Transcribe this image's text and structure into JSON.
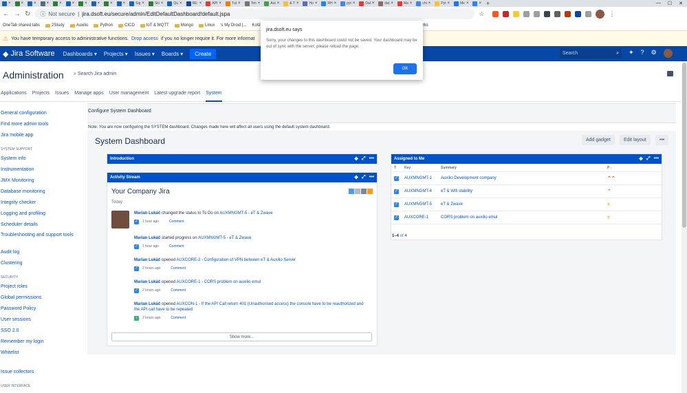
{
  "browser": {
    "tabs": [
      {
        "label": "",
        "color": "#1565c0"
      },
      {
        "label": "",
        "color": "#2e7d32"
      },
      {
        "label": "",
        "color": "#1565c0"
      },
      {
        "label": "",
        "color": "#546e7a"
      },
      {
        "label": "",
        "color": "#2e7d32"
      },
      {
        "label": "",
        "color": "#1565c0"
      },
      {
        "label": "",
        "color": "#2e7d32"
      },
      {
        "label": "",
        "color": "#1565c0"
      },
      {
        "label": "",
        "color": "#2e7d32"
      },
      {
        "label": "",
        "color": "#1565c0"
      },
      {
        "label": "Sig",
        "color": "#1565c0"
      },
      {
        "label": "Ski",
        "color": "#2e7d32"
      },
      {
        "label": "Qu",
        "color": "#1565c0"
      },
      {
        "label": "RE:",
        "color": "#0d47a1"
      },
      {
        "label": "API",
        "color": "#e53935"
      },
      {
        "label": "Tut",
        "color": "#f57c00"
      },
      {
        "label": "Tim",
        "color": "#757575"
      },
      {
        "label": "Aut",
        "color": "#43a047"
      },
      {
        "label": "& T",
        "color": "#fbc02d"
      },
      {
        "label": "Ho",
        "color": "#5c6bc0"
      },
      {
        "label": "RH",
        "color": "#1e88e5"
      },
      {
        "label": "pyt",
        "color": "#4285f4"
      },
      {
        "label": "Dal",
        "color": "#e53935"
      },
      {
        "label": "dat",
        "color": "#8d6e63"
      },
      {
        "label": "Ma",
        "color": "#e53935"
      },
      {
        "label": "chi",
        "color": "#4285f4"
      },
      {
        "label": "Pyt",
        "color": "#fbc02d"
      },
      {
        "label": "Me",
        "color": "#1877f2"
      },
      {
        "label": "",
        "color": "#2684ff"
      }
    ],
    "new_tab": "+",
    "window_controls": [
      "—",
      "☐",
      "✕"
    ],
    "not_secure": "Not secure",
    "url": "jira.dsoft.eu/secure/admin/EditDefaultDashboard!default.jspa",
    "extension_colors": [
      "#ff5722",
      "#c62828",
      "#ffca28",
      "#9e9e9e",
      "#9e9e9e",
      "#37474f",
      "#616161",
      "#bf360c",
      "#0d47a1",
      "#9e9e9e"
    ],
    "bookmarks": [
      {
        "label": "OneTab shared tabs",
        "folder": false
      },
      {
        "label": "2Study",
        "folder": true
      },
      {
        "label": "Auxilio",
        "folder": true
      },
      {
        "label": "Python",
        "folder": true
      },
      {
        "label": "CICD",
        "folder": true
      },
      {
        "label": "IoT & MQTT",
        "folder": true
      },
      {
        "label": "Mongo",
        "folder": true
      },
      {
        "label": "Linux",
        "folder": true
      },
      {
        "label": "'s My Droid |...",
        "folder": false
      },
      {
        "label": "Košík | Zlavomat.sk",
        "folder": false
      },
      {
        "label": "Neven N°blue HD P...",
        "folder": false
      },
      {
        "label": "HTTP authenticatio...",
        "folder": false
      },
      {
        "label": "»",
        "folder": false
      },
      {
        "label": "Other bookmarks",
        "folder": true
      }
    ]
  },
  "banner": {
    "prefix": "You have temporary access to administrative functions.",
    "link": "Drop access",
    "suffix": "if you no longer require it. For more informat"
  },
  "jira_nav": {
    "product": "Jira Software",
    "menus": [
      "Dashboards",
      "Projects",
      "Issues",
      "Boards"
    ],
    "create": "Create",
    "search_placeholder": "Search"
  },
  "admin": {
    "title": "Administration",
    "search": "Search Jira admin",
    "tabs": [
      "Applications",
      "Projects",
      "Issues",
      "Manage apps",
      "User management",
      "Latest upgrade report",
      "System"
    ],
    "active_tab": "System"
  },
  "sidebar": [
    {
      "type": "item",
      "label": "General configuration"
    },
    {
      "type": "item",
      "label": "Find more admin tools"
    },
    {
      "type": "item",
      "label": "Jira mobile app"
    },
    {
      "type": "head",
      "label": "SYSTEM SUPPORT"
    },
    {
      "type": "item",
      "label": "System info"
    },
    {
      "type": "item",
      "label": "Instrumentation"
    },
    {
      "type": "item",
      "label": "JMX Monitoring"
    },
    {
      "type": "item",
      "label": "Database monitoring"
    },
    {
      "type": "item",
      "label": "Integrity checker"
    },
    {
      "type": "item",
      "label": "Logging and profiling"
    },
    {
      "type": "item",
      "label": "Scheduler details"
    },
    {
      "type": "item",
      "label": "Troubleshooting and support tools"
    },
    {
      "type": "item",
      "label": "Audit log"
    },
    {
      "type": "item",
      "label": "Clustering"
    },
    {
      "type": "head",
      "label": "SECURITY"
    },
    {
      "type": "item",
      "label": "Project roles"
    },
    {
      "type": "item",
      "label": "Global permissions"
    },
    {
      "type": "item",
      "label": "Password Policy"
    },
    {
      "type": "item",
      "label": "User sessions"
    },
    {
      "type": "item",
      "label": "SSO 2.0"
    },
    {
      "type": "item",
      "label": "Remember my login"
    },
    {
      "type": "item",
      "label": "Whitelist"
    },
    {
      "type": "item",
      "label": "Issue collectors"
    },
    {
      "type": "head",
      "label": "USER INTERFACE"
    }
  ],
  "content": {
    "section_title": "Configure System Dashboard",
    "note": "Note: You are now configuring the SYSTEM dashboard. Changes made here will affect all users using the default system dashboard.",
    "dashboard_title": "System Dashboard",
    "add_gadget": "Add gadget",
    "edit_layout": "Edit layout",
    "more": "•••"
  },
  "gadgets": {
    "introduction": "Introduction",
    "activity_stream": "Activity Stream",
    "assigned": "Assigned to Me",
    "tool_icons": [
      "✥",
      "⤢",
      "•••"
    ]
  },
  "activity": {
    "heading": "Your Company Jira",
    "today": "Today",
    "comment": "Comment",
    "show_more": "Show more...",
    "entries": [
      {
        "user": "Marian Lukáč",
        "action": "changed the status to To Do on",
        "issue": "AUXMNGMT-5 - eT & Zwave",
        "time": "1 hour ago",
        "check": "blue"
      },
      {
        "user": "Marian Lukáč",
        "action": "started progress on",
        "issue": "AUXMNGMT-5 - eT & Zwave",
        "time": "1 hour ago",
        "check": "blue"
      },
      {
        "user": "Marian Lukáč",
        "action": "opened",
        "issue": "AUXCORE-2 - Configuration of VPN between eT & Auxilio Server",
        "time": "2 hours ago",
        "check": "blue"
      },
      {
        "user": "Marian Lukáč",
        "action": "opened",
        "issue": "AUXCORE-1 - CORS problem on auxilio emul",
        "time": "2 hours ago",
        "check": "blue"
      },
      {
        "user": "Marian Lukáč",
        "action": "opened",
        "issue": "AUXCON-1 - If the API Call return 401 (Unauthorised access) the console have to be reauthorized and the API call have to be repeated",
        "time": "2 hours ago",
        "check": "green"
      }
    ]
  },
  "assigned_table": {
    "headers": {
      "type": "T",
      "key": "Key",
      "summary": "Summary",
      "priority": "P ↓"
    },
    "rows": [
      {
        "key": "AUXMNGMT-1",
        "summary": "Auxilio Development company",
        "priority": "⌃⌃",
        "priority_color": "#de350b"
      },
      {
        "key": "AUXMNGMT-4",
        "summary": "eT & Wifi stability",
        "priority": "⌃",
        "priority_color": "#ff5630"
      },
      {
        "key": "AUXMNGMT-5",
        "summary": "eT & Zwave",
        "priority": "=",
        "priority_color": "#ffab00"
      },
      {
        "key": "AUXCORE-1",
        "summary": "CORS problem on auxilio emul",
        "priority": "=",
        "priority_color": "#ffab00"
      }
    ],
    "footer_range": "1–4",
    "footer_of": "of",
    "footer_total": "4"
  },
  "dialog": {
    "title": "jira.dsoft.eu says",
    "message": "Sorry, your changes to this dashboard could not be saved. Your dashboard may be out of sync with the server; please reload the page.",
    "ok": "OK"
  }
}
